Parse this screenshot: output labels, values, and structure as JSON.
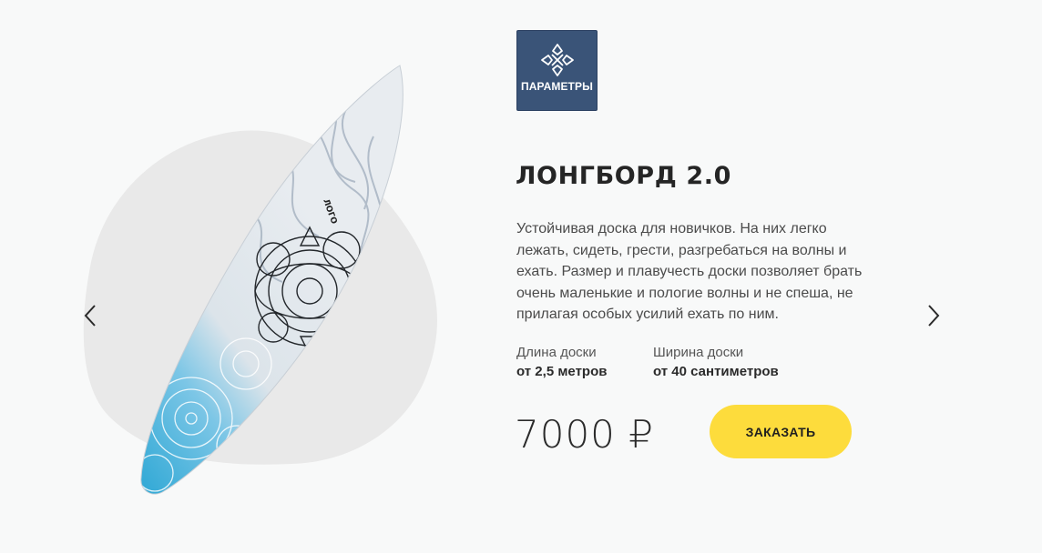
{
  "colors": {
    "background": "#f8f9f9",
    "blob": "#e9e9e9",
    "badge": "#3a5478",
    "button": "#fddc3c",
    "board_blue": "#28a5d2",
    "board_marble": "#d5dbe3"
  },
  "carousel": {
    "prev_icon": "chevron-left-icon",
    "next_icon": "chevron-right-icon"
  },
  "badge": {
    "icon": "compass-ornament-icon",
    "label": "ПАРАМЕТРЫ"
  },
  "product": {
    "title": "ЛОНГБОРД 2.0",
    "description": "Устойчивая доска для новичков. На них легко лежать, сидеть, грести, разгребаться на волны и ехать. Размер и плавучесть доски позволяет брать очень маленькие и пологие волны и не спеша, не прилагая особых усилий ехать по ним.",
    "specs": [
      {
        "label": "Длина доски",
        "value": "от 2,5 метров"
      },
      {
        "label": "Ширина доски",
        "value": "от 40 сантиметров"
      }
    ],
    "price": "7000 ₽",
    "order_label": "ЗАКАЗАТЬ"
  }
}
